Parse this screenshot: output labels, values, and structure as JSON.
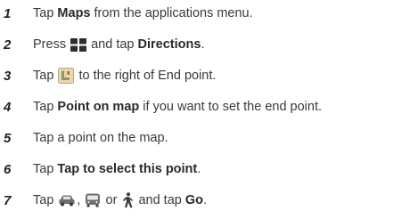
{
  "steps": [
    {
      "number": "1",
      "parts": [
        {
          "t": "text",
          "v": "Tap "
        },
        {
          "t": "bold",
          "v": "Maps"
        },
        {
          "t": "text",
          "v": " from the applications menu."
        }
      ]
    },
    {
      "number": "2",
      "parts": [
        {
          "t": "text",
          "v": "Press "
        },
        {
          "t": "icon",
          "icon": "menu-grid-icon"
        },
        {
          "t": "text",
          "v": " and tap "
        },
        {
          "t": "bold",
          "v": "Directions"
        },
        {
          "t": "text",
          "v": "."
        }
      ]
    },
    {
      "number": "3",
      "parts": [
        {
          "t": "text",
          "v": "Tap "
        },
        {
          "t": "icon",
          "icon": "map-pin-select-icon"
        },
        {
          "t": "text",
          "v": " to the right of End point."
        }
      ]
    },
    {
      "number": "4",
      "parts": [
        {
          "t": "text",
          "v": "Tap "
        },
        {
          "t": "bold",
          "v": "Point on map"
        },
        {
          "t": "text",
          "v": " if you want to set the end point."
        }
      ]
    },
    {
      "number": "5",
      "parts": [
        {
          "t": "text",
          "v": "Tap a point on the map."
        }
      ]
    },
    {
      "number": "6",
      "parts": [
        {
          "t": "text",
          "v": "Tap "
        },
        {
          "t": "bold",
          "v": "Tap to select this point"
        },
        {
          "t": "text",
          "v": "."
        }
      ]
    },
    {
      "number": "7",
      "parts": [
        {
          "t": "text",
          "v": "Tap "
        },
        {
          "t": "icon",
          "icon": "car-icon"
        },
        {
          "t": "text",
          "v": ", "
        },
        {
          "t": "icon",
          "icon": "bus-icon"
        },
        {
          "t": "text",
          "v": " or "
        },
        {
          "t": "icon",
          "icon": "walking-icon"
        },
        {
          "t": "text",
          "v": " and tap "
        },
        {
          "t": "bold",
          "v": "Go"
        },
        {
          "t": "text",
          "v": "."
        }
      ]
    }
  ],
  "colors": {
    "text": "#3a3a3a",
    "bold_text": "#2a2a2a",
    "icon_dark": "#2e2e2e",
    "icon_gray": "#6e6e6e",
    "pin_icon_fill": "#e8d9a8"
  }
}
